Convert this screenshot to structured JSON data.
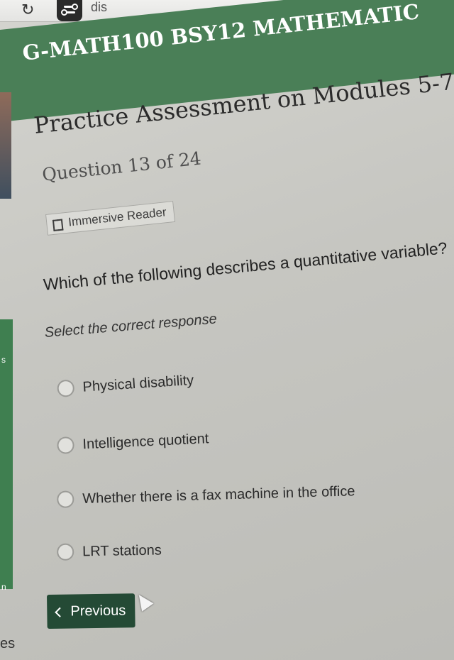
{
  "browser": {
    "tab_fragment": "dis"
  },
  "header": {
    "course_title": "G-MATH100 BSY12 MATHEMATIC",
    "assessment_title": "Practice Assessment on Modules 5-7",
    "question_counter": "Question 13 of 24"
  },
  "toolbar": {
    "immersive_reader_label": "Immersive Reader"
  },
  "question": {
    "text": "Which of the following describes a quantitative variable?",
    "instruction": "Select the correct response",
    "options": [
      {
        "label": "Physical disability"
      },
      {
        "label": "Intelligence quotient"
      },
      {
        "label": "Whether there is a fax machine in the office"
      },
      {
        "label": "LRT stations"
      }
    ]
  },
  "navigation": {
    "previous_label": "Previous"
  },
  "fragments": {
    "side_s": "s",
    "side_n": "n",
    "bottom_es": "es"
  },
  "colors": {
    "header_green": "#4a7f57",
    "button_green": "#244a35"
  }
}
